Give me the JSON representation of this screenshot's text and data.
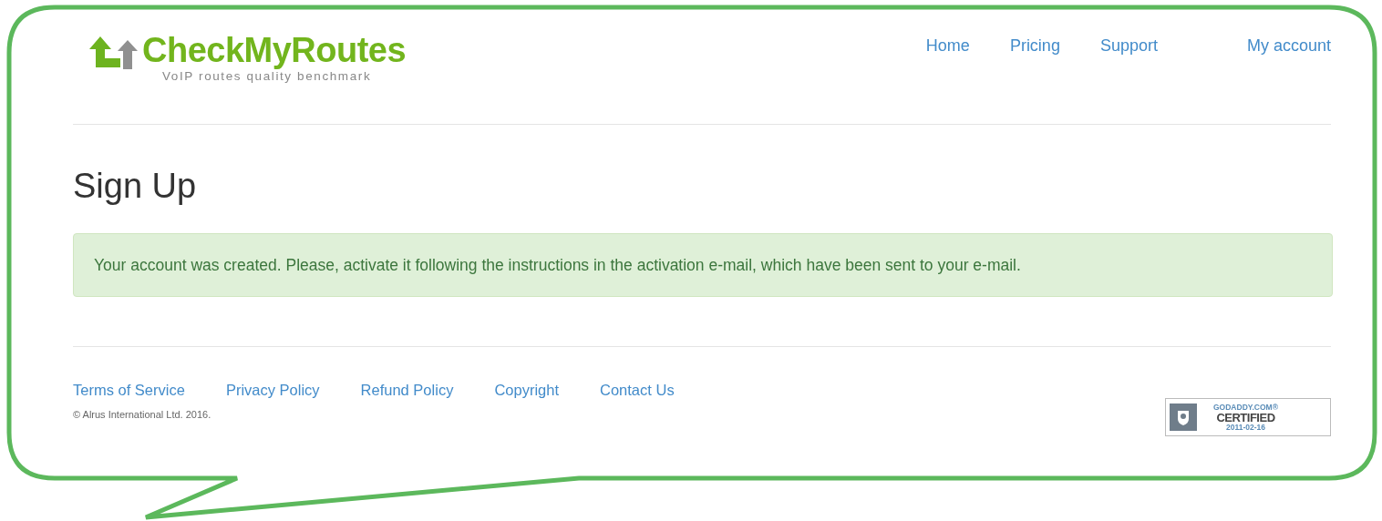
{
  "logo": {
    "name": "CheckMyRoutes",
    "tagline": "VoIP routes quality benchmark"
  },
  "nav": [
    {
      "label": "Home"
    },
    {
      "label": "Pricing"
    },
    {
      "label": "Support"
    },
    {
      "label": "My account"
    }
  ],
  "heading": "Sign Up",
  "alert": "Your account was created. Please, activate it following the instructions in the activation e-mail, which have been sent to your e-mail.",
  "footer_links": [
    "Terms of Service",
    "Privacy Policy",
    "Refund Policy",
    "Copyright",
    "Contact Us"
  ],
  "copyright": "© Alrus International Ltd. 2016.",
  "badge": {
    "brand": "GODADDY.COM®",
    "status": "CERTIFIED",
    "date": "2011-02-16"
  }
}
